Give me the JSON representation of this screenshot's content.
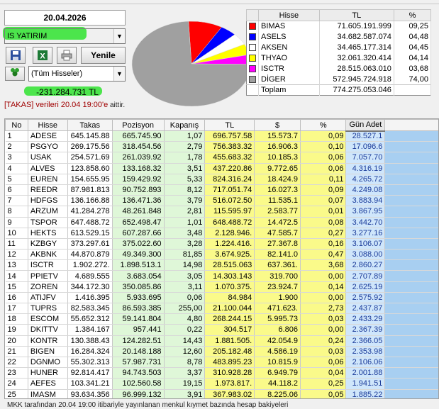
{
  "date": "20.04.2026",
  "account": {
    "selected": "IS YATIRIM"
  },
  "toolbar": {
    "refresh_label": "Yenile"
  },
  "filter": {
    "selected": "(Tüm Hisseler)"
  },
  "total_value": "-231.284.731 TL",
  "info_note": {
    "main": "[TAKAS] verileri 20.04 19:00'e",
    "suffix": " aittir."
  },
  "legend": {
    "headers": [
      "Hisse",
      "TL",
      "%"
    ],
    "rows": [
      {
        "name": "BIMAS",
        "tl": "71.605.191.999",
        "pct": "09,25",
        "color": "#ff0000"
      },
      {
        "name": "ASELS",
        "tl": "34.682.587.074",
        "pct": "04,48",
        "color": "#0000ff"
      },
      {
        "name": "AKSEN",
        "tl": "34.465.177.314",
        "pct": "04,45",
        "color": "#ffffff"
      },
      {
        "name": "THYAO",
        "tl": "32.061.320.414",
        "pct": "04,14",
        "color": "#ffff00"
      },
      {
        "name": "ISCTR",
        "tl": "28.515.063.010",
        "pct": "03,68",
        "color": "#ff00ff"
      },
      {
        "name": "DİGER",
        "tl": "572.945.724.918",
        "pct": "74,00",
        "color": "#a0a0a0"
      },
      {
        "name": "Toplam",
        "tl": "774.275.053.046",
        "pct": "",
        "color": ""
      }
    ]
  },
  "pie_colors": [
    "#a0a0a0",
    "#ff0000",
    "#0000ff",
    "#ffffff",
    "#ffff00",
    "#ff00ff"
  ],
  "grid": {
    "headers": [
      "No",
      "Hisse",
      "Takas",
      "Pozisyon",
      "Kapanış",
      "TL",
      "$",
      "%",
      "Gün Adet"
    ],
    "rows": [
      [
        "1",
        "ADESE",
        "645.145.88",
        "665.745.90",
        "1,07",
        "696.757.58",
        "15.573.7",
        "0,09",
        "28.527.1"
      ],
      [
        "2",
        "PSGYO",
        "269.175.56",
        "318.454.56",
        "2,79",
        "756.383.32",
        "16.906.3",
        "0,10",
        "17.096.6"
      ],
      [
        "3",
        "USAK",
        "254.571.69",
        "261.039.92",
        "1,78",
        "455.683.32",
        "10.185.3",
        "0,06",
        "7.057.70"
      ],
      [
        "4",
        "ALVES",
        "123.858.60",
        "133.168.32",
        "3,51",
        "437.220.86",
        "9.772.65",
        "0,06",
        "4.316.19"
      ],
      [
        "5",
        "EUREN",
        "154.655.95",
        "159.429.92",
        "5,33",
        "824.316.24",
        "18.424.9",
        "0,11",
        "4.265.72"
      ],
      [
        "6",
        "REEDR",
        "87.981.813",
        "90.752.893",
        "8,12",
        "717.051.74",
        "16.027.3",
        "0,09",
        "4.249.08"
      ],
      [
        "7",
        "HDFGS",
        "136.166.88",
        "136.471.36",
        "3,79",
        "516.072.50",
        "11.535.1",
        "0,07",
        "3.883.94"
      ],
      [
        "8",
        "ARZUM",
        "41.284.278",
        "48.261.848",
        "2,81",
        "115.595.97",
        "2.583.77",
        "0,01",
        "3.867.95"
      ],
      [
        "9",
        "TSPOR",
        "647.488.72",
        "652.498.47",
        "1,01",
        "648.488.72",
        "14.472.5",
        "0,08",
        "3.442.70"
      ],
      [
        "10",
        "HEKTS",
        "613.529.15",
        "607.287.66",
        "3,48",
        "2.128.946.",
        "47.585.7",
        "0,27",
        "3.277.16"
      ],
      [
        "11",
        "KZBGY",
        "373.297.61",
        "375.022.60",
        "3,28",
        "1.224.416.",
        "27.367.8",
        "0,16",
        "3.106.07"
      ],
      [
        "12",
        "AKBNK",
        "44.870.879",
        "49.349.300",
        "81,85",
        "3.674.925.",
        "82.141.0",
        "0,47",
        "3.088.00"
      ],
      [
        "13",
        "ISCTR",
        "1.902.272.",
        "1.898.513.1",
        "14,98",
        "28.515.063",
        "637.361.",
        "3,68",
        "2.860.27"
      ],
      [
        "14",
        "PPIETV",
        "4.689.555",
        "3.683.054",
        "3,05",
        "14.303.143",
        "319.700",
        "0,00",
        "2.707.89"
      ],
      [
        "15",
        "ZOREN",
        "344.172.30",
        "350.085.86",
        "3,11",
        "1.070.375.",
        "23.924.7",
        "0,14",
        "2.625.19"
      ],
      [
        "16",
        "ATIJFV",
        "1.416.395",
        "5.933.695",
        "0,06",
        "84.984",
        "1.900",
        "0,00",
        "2.575.92"
      ],
      [
        "17",
        "TUPRS",
        "82.583.345",
        "86.593.385",
        "255,00",
        "21.100.044",
        "471.623.",
        "2,73",
        "2.437.87"
      ],
      [
        "18",
        "ESCOM",
        "55.652.312",
        "59.141.804",
        "4,80",
        "268.244.15",
        "5.995.73",
        "0,03",
        "2.433.29"
      ],
      [
        "19",
        "DKITTV",
        "1.384.167",
        "957.441",
        "0,22",
        "304.517",
        "6.806",
        "0,00",
        "2.367.39"
      ],
      [
        "20",
        "KONTR",
        "130.388.43",
        "124.282.51",
        "14,43",
        "1.881.505.",
        "42.054.9",
        "0,24",
        "2.366.05"
      ],
      [
        "21",
        "BIGEN",
        "16.284.324",
        "20.148.188",
        "12,60",
        "205.182.48",
        "4.586.19",
        "0,03",
        "2.353.98"
      ],
      [
        "22",
        "DGNMO",
        "55.302.313",
        "57.987.731",
        "8,78",
        "483.895.23",
        "10.815.9",
        "0,06",
        "2.106.06"
      ],
      [
        "23",
        "HUNER",
        "92.814.417",
        "94.743.503",
        "3,37",
        "310.928.28",
        "6.949.79",
        "0,04",
        "2.001.88"
      ],
      [
        "24",
        "AEFES",
        "103.341.21",
        "102.560.58",
        "19,15",
        "1.973.817.",
        "44.118.2",
        "0,25",
        "1.941.51"
      ],
      [
        "25",
        "IMASM",
        "93.634.356",
        "96.999.132",
        "3,91",
        "367.983.02",
        "8.225.06",
        "0,05",
        "1.885.22"
      ]
    ]
  },
  "footer": "MKK tarafından 20.04 19:00 itibariyle yayınlanan menkul kıymet bazında hesap bakiyeleri"
}
